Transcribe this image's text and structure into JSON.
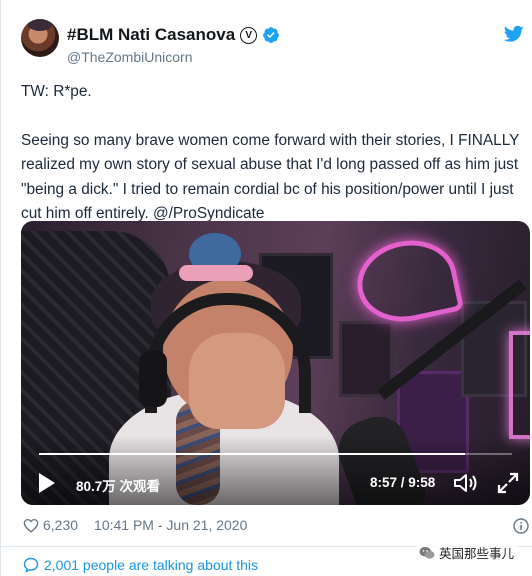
{
  "user": {
    "display_name": "#BLM Nati Casanova",
    "handle": "@TheZombiUnicorn",
    "badge_letter": "V"
  },
  "tweet": {
    "line1": "TW: R*pe.",
    "body": "Seeing so many brave women come forward with their stories, I FINALLY realized my own story of sexual abuse that I'd long passed off as him just \"being a dick.\" I tried to remain cordial bc of his position/power until I just cut him off entirely. @/ProSyndicate"
  },
  "video": {
    "views": "80.7万 次观看",
    "time": "8:57 / 9:58",
    "progress": 0.9
  },
  "footer": {
    "likes": "6,230",
    "timestamp": "10:41 PM - Jun 21, 2020",
    "talking": "2,001 people are talking about this"
  },
  "watermark": {
    "text": "英国那些事儿"
  },
  "colors": {
    "link": "#1b95e0",
    "verified": "#1da1f2",
    "muted": "#657786"
  }
}
